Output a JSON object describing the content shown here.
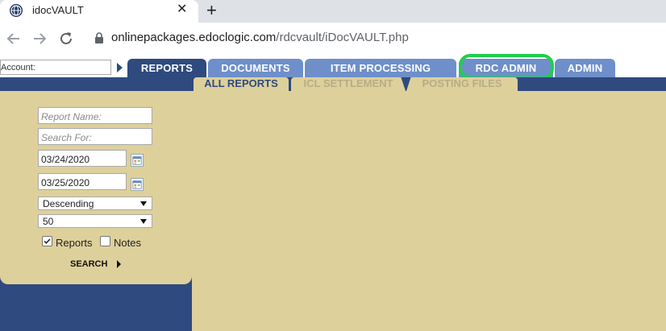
{
  "browser": {
    "tab_title": "idocVAULT",
    "tab_close": "✕",
    "new_tab": "+",
    "url_host": "onlinepackages.edoclogic.com",
    "url_path": "/rdcvault/iDocVAULT.php"
  },
  "account": {
    "placeholder": "Account:"
  },
  "main_tabs": [
    {
      "label": "REPORTS",
      "active": true
    },
    {
      "label": "DOCUMENTS"
    },
    {
      "label": "ITEM PROCESSING"
    },
    {
      "label": "RDC ADMIN",
      "highlighted": true
    },
    {
      "label": "ADMIN"
    }
  ],
  "sub_tabs": [
    {
      "label": "ALL REPORTS",
      "active": true
    },
    {
      "label": "ICL SETTLEMENT"
    },
    {
      "label": "POSTING FILES"
    }
  ],
  "form": {
    "report_name_placeholder": "Report Name:",
    "search_for_placeholder": "Search For:",
    "start_date": "03/24/2020",
    "end_date": "03/25/2020",
    "sort_order": "Descending",
    "page_size": "50",
    "reports_checkbox": {
      "label": "Reports",
      "checked": true
    },
    "notes_checkbox": {
      "label": "Notes",
      "checked": false
    },
    "search_label": "SEARCH"
  },
  "colors": {
    "navy": "#2e4a7f",
    "tab_blue": "#6e8fc9",
    "tan": "#ddd09b",
    "highlight_green": "#1ed04a"
  }
}
